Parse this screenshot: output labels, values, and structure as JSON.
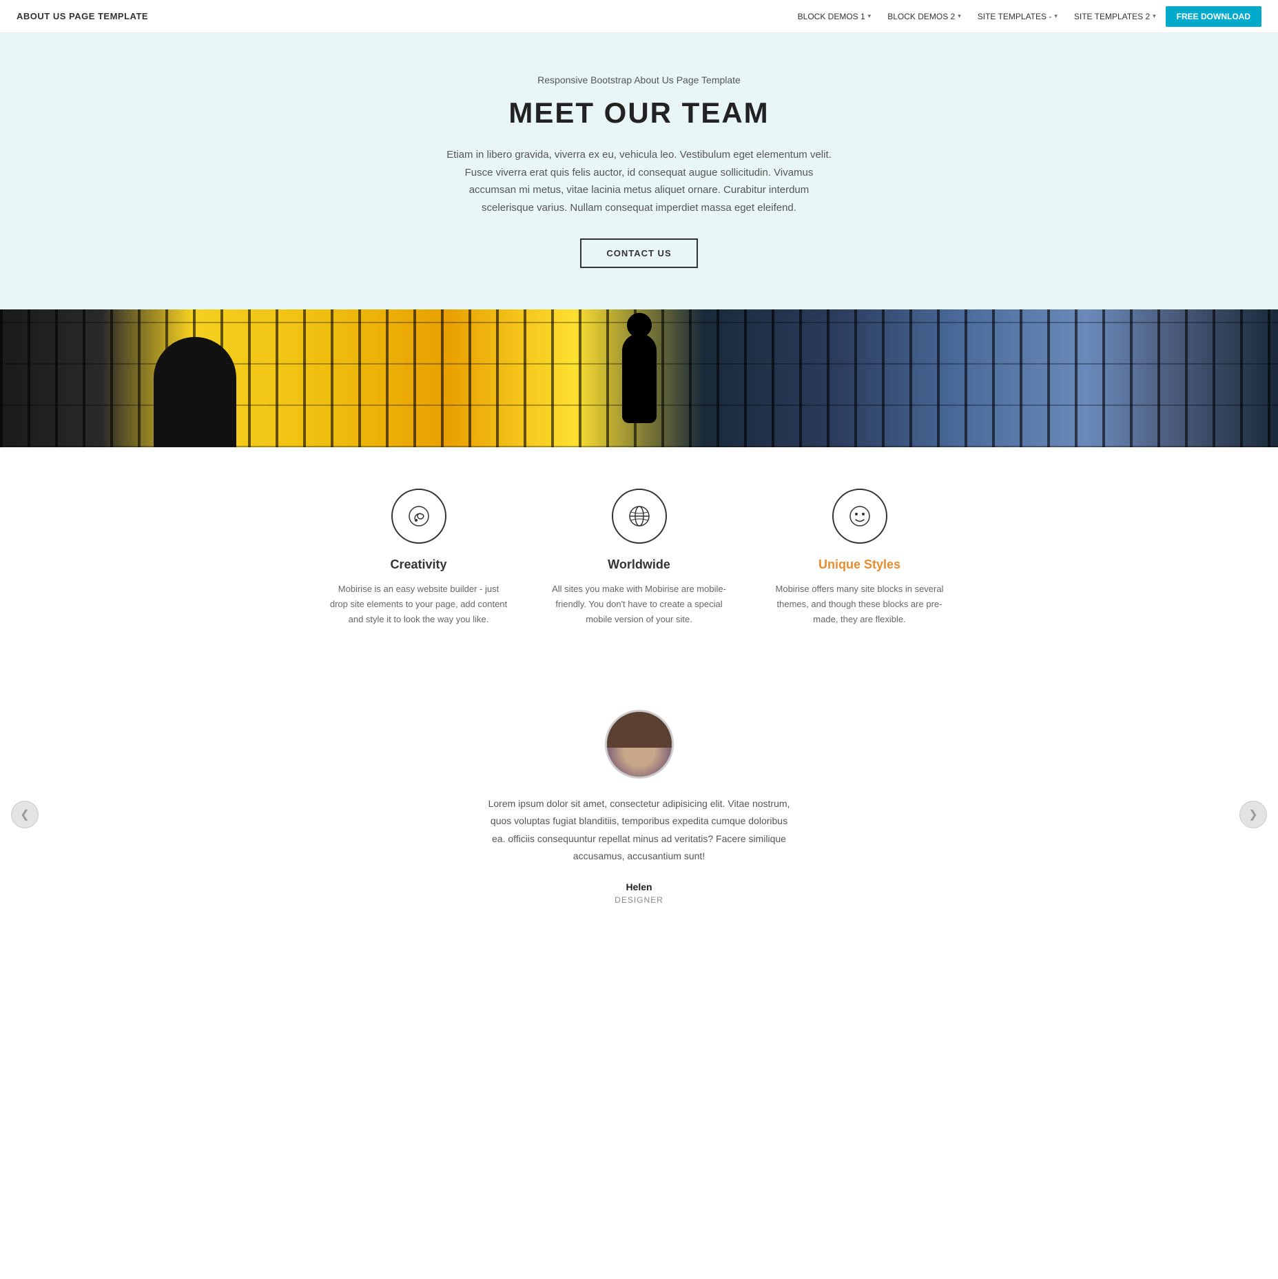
{
  "navbar": {
    "brand": "ABOUT US PAGE TEMPLATE",
    "links": [
      {
        "label": "BLOCK DEMOS 1",
        "hasDropdown": true
      },
      {
        "label": "BLOCK DEMOS 2",
        "hasDropdown": true
      },
      {
        "label": "SITE TEMPLATES -",
        "hasDropdown": true
      },
      {
        "label": "SITE TEMPLATES 2",
        "hasDropdown": true
      }
    ],
    "cta_label": "FREE DOWNLOAD"
  },
  "hero": {
    "subtitle": "Responsive Bootstrap About Us Page Template",
    "title": "MEET OUR TEAM",
    "text": "Etiam in libero gravida, viverra ex eu, vehicula leo. Vestibulum eget elementum velit. Fusce viverra erat quis felis auctor, id consequat augue sollicitudin. Vivamus accumsan mi metus, vitae lacinia metus aliquet ornare. Curabitur interdum scelerisque varius. Nullam consequat imperdiet massa eget eleifend.",
    "cta_label": "CONTACT US"
  },
  "features": [
    {
      "icon": "🧠",
      "title": "Creativity",
      "highlight": false,
      "desc": "Mobirise is an easy website builder - just drop site elements to your page, add content and style it to look the way you like."
    },
    {
      "icon": "🌍",
      "title": "Worldwide",
      "highlight": false,
      "desc": "All sites you make with Mobirise are mobile-friendly. You don't have to create a special mobile version of your site."
    },
    {
      "icon": "🙂",
      "title": "Unique Styles",
      "highlight": true,
      "desc": "Mobirise offers many site blocks in several themes, and though these blocks are pre-made, they are flexible."
    }
  ],
  "testimonial": {
    "text": "Lorem ipsum dolor sit amet, consectetur adipisicing elit. Vitae nostrum, quos voluptas fugiat blanditiis, temporibus expedita cumque doloribus ea. officiis consequuntur repellat minus ad veritatis? Facere similique accusamus, accusantium sunt!",
    "name": "Helen",
    "role": "DESIGNER",
    "prev_arrow": "❮",
    "next_arrow": "❯"
  },
  "colors": {
    "accent": "#00aacc",
    "highlight": "#e88c30",
    "hero_bg": "#e8f6f8"
  }
}
